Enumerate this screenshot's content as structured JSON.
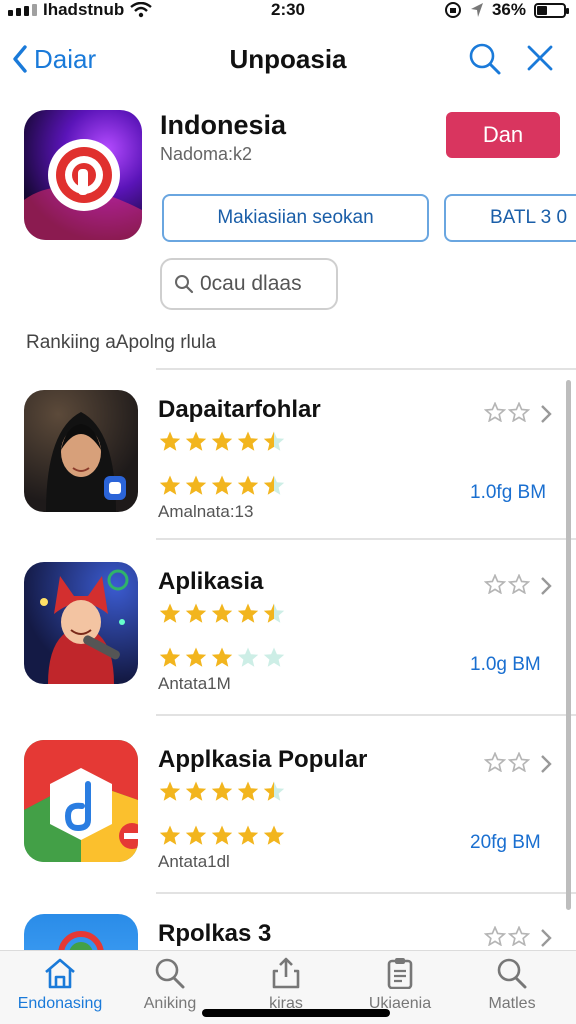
{
  "status": {
    "carrier": "Ihadstnub",
    "time": "2:30",
    "battery_pct": "36%",
    "battery_level": 0.36
  },
  "nav": {
    "back_label": "Daiar",
    "title": "Unpoasia"
  },
  "hero": {
    "name": "Indonesia",
    "subtitle": "Nadoma:k2",
    "get_label": "Dan",
    "pill1": "Makiasiian seokan",
    "pill2": "BATL 3 0",
    "search_placeholder": "0cau dlaas"
  },
  "section_label": "Rankiing aApolng rlula",
  "items": [
    {
      "name": "Dapaitarfohlar",
      "stars_top": 4.5,
      "stars_bottom": 4.5,
      "meta": "Amalnata:13",
      "size": "1.0fg BM"
    },
    {
      "name": "Aplikasia",
      "stars_top": 4.5,
      "stars_bottom": 3,
      "meta": "Antata1M",
      "size": "1.0g BM"
    },
    {
      "name": "Applkasia Popular",
      "stars_top": 4.5,
      "stars_bottom": 5,
      "meta": "Antata1dl",
      "size": "20fg BM"
    },
    {
      "name": "Rpolkas 3"
    }
  ],
  "tabs": [
    {
      "label": "Endonasing",
      "icon": "home-icon",
      "active": true
    },
    {
      "label": "Aniking",
      "icon": "search-icon",
      "active": false
    },
    {
      "label": "kiras",
      "icon": "share-icon",
      "active": false
    },
    {
      "label": "Ukiaenia",
      "icon": "clipboard-icon",
      "active": false
    },
    {
      "label": "Matles",
      "icon": "search-icon",
      "active": false
    }
  ],
  "colors": {
    "accent": "#1a7ad9",
    "get_button": "#d9355f",
    "star": "#f2b51e",
    "star_empty": "#cdeee6"
  }
}
